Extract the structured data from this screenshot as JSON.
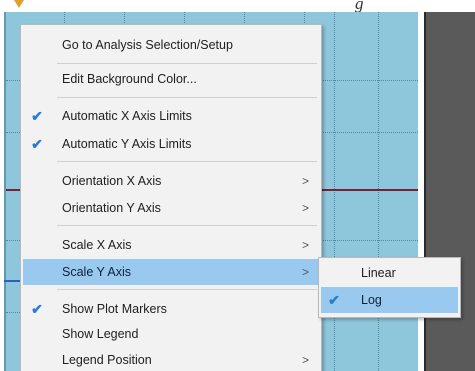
{
  "caption": "g",
  "context_menu": {
    "items": [
      {
        "label": "Go to Analysis Selection/Setup",
        "checked": false,
        "has_submenu": false,
        "highlighted": false
      },
      {
        "label": "Edit Background Color...",
        "checked": false,
        "has_submenu": false,
        "highlighted": false
      },
      {
        "label": "Automatic X Axis Limits",
        "checked": true,
        "has_submenu": false,
        "highlighted": false
      },
      {
        "label": "Automatic Y Axis Limits",
        "checked": true,
        "has_submenu": false,
        "highlighted": false
      },
      {
        "label": "Orientation X Axis",
        "checked": false,
        "has_submenu": true,
        "highlighted": false
      },
      {
        "label": "Orientation Y Axis",
        "checked": false,
        "has_submenu": true,
        "highlighted": false
      },
      {
        "label": "Scale X Axis",
        "checked": false,
        "has_submenu": true,
        "highlighted": false
      },
      {
        "label": "Scale Y Axis",
        "checked": false,
        "has_submenu": true,
        "highlighted": true
      },
      {
        "label": "Show Plot Markers",
        "checked": true,
        "has_submenu": false,
        "highlighted": false
      },
      {
        "label": "Show Legend",
        "checked": false,
        "has_submenu": false,
        "highlighted": false
      },
      {
        "label": "Legend Position",
        "checked": false,
        "has_submenu": true,
        "highlighted": false
      }
    ],
    "check_glyph": "✔",
    "submenu_glyph": ">"
  },
  "scale_submenu": {
    "items": [
      {
        "label": "Linear",
        "checked": false,
        "highlighted": false
      },
      {
        "label": "Log",
        "checked": true,
        "highlighted": true
      }
    ]
  },
  "colors": {
    "plot_background": "#8ec6db",
    "highlight": "#99c9ef",
    "check": "#2a7bd6",
    "trace_red": "#7a1f34",
    "trace_blue": "#2b5fc0",
    "side_panel": "#5a5a5a"
  }
}
